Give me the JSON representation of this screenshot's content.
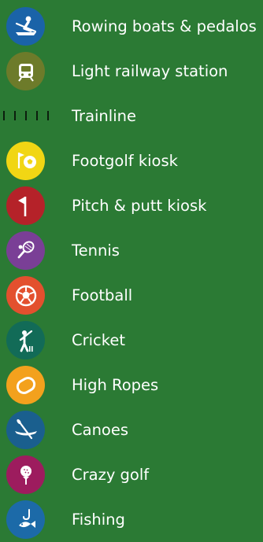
{
  "legend": {
    "items": [
      {
        "label": "Rowing boats & pedalos",
        "icon": "rowing-icon",
        "color": "#1a63a8"
      },
      {
        "label": "Light railway station",
        "icon": "railway-station-icon",
        "color": "#6d7b2a"
      },
      {
        "label": "Trainline",
        "icon": "trainline-dashes",
        "color": "#0b1e0d"
      },
      {
        "label": "Footgolf kiosk",
        "icon": "footgolf-icon",
        "color": "#f1d614"
      },
      {
        "label": "Pitch & putt kiosk",
        "icon": "pitch-putt-flag-icon",
        "color": "#b52229"
      },
      {
        "label": "Tennis",
        "icon": "tennis-racket-icon",
        "color": "#7a3f96"
      },
      {
        "label": "Football",
        "icon": "football-icon",
        "color": "#e3502e"
      },
      {
        "label": "Cricket",
        "icon": "cricket-batter-icon",
        "color": "#126b57"
      },
      {
        "label": "High Ropes",
        "icon": "carabiner-icon",
        "color": "#f3a11d"
      },
      {
        "label": "Canoes",
        "icon": "canoe-icon",
        "color": "#1a5f8e"
      },
      {
        "label": "Crazy golf",
        "icon": "golf-ball-tee-icon",
        "color": "#9d1c5e"
      },
      {
        "label": "Fishing",
        "icon": "fishing-icon",
        "color": "#1c6aa8"
      }
    ]
  }
}
